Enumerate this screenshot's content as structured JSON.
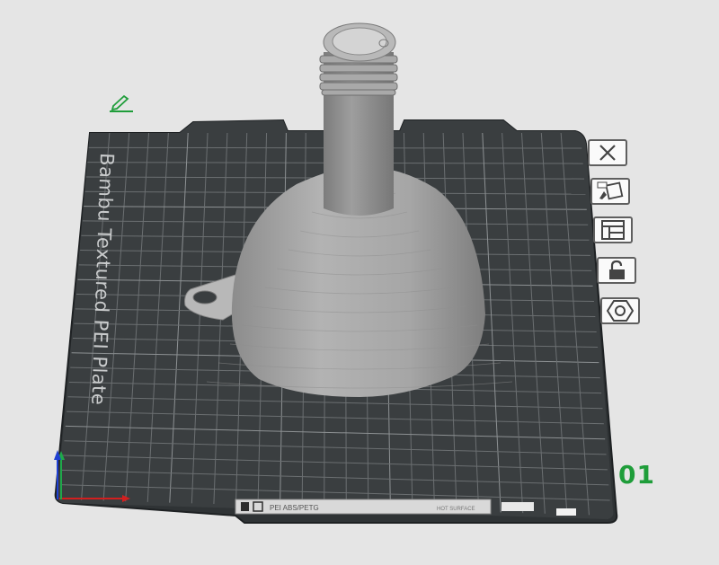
{
  "plate": {
    "name": "Bambu Textured PEI Plate",
    "number": "01",
    "label_text": "PEI ABS/PETG",
    "label_subtext": "HOT SURFACE"
  },
  "toolbar": {
    "delete_icon": "close-x-icon",
    "auto_orient_icon": "auto-orient-icon",
    "arrange_icon": "arrange-layout-icon",
    "lock_icon": "unlock-icon",
    "settings_icon": "hex-nut-icon"
  },
  "colors": {
    "bed": "#3a3e40",
    "grid": "#6b6f71",
    "model": "#9a9a9a",
    "plate_number": "#1f9d3a",
    "edit_icon": "#1f9d3a",
    "axis_x": "#d21f1f",
    "axis_y": "#1fa84a",
    "axis_z": "#1f3fd2"
  }
}
